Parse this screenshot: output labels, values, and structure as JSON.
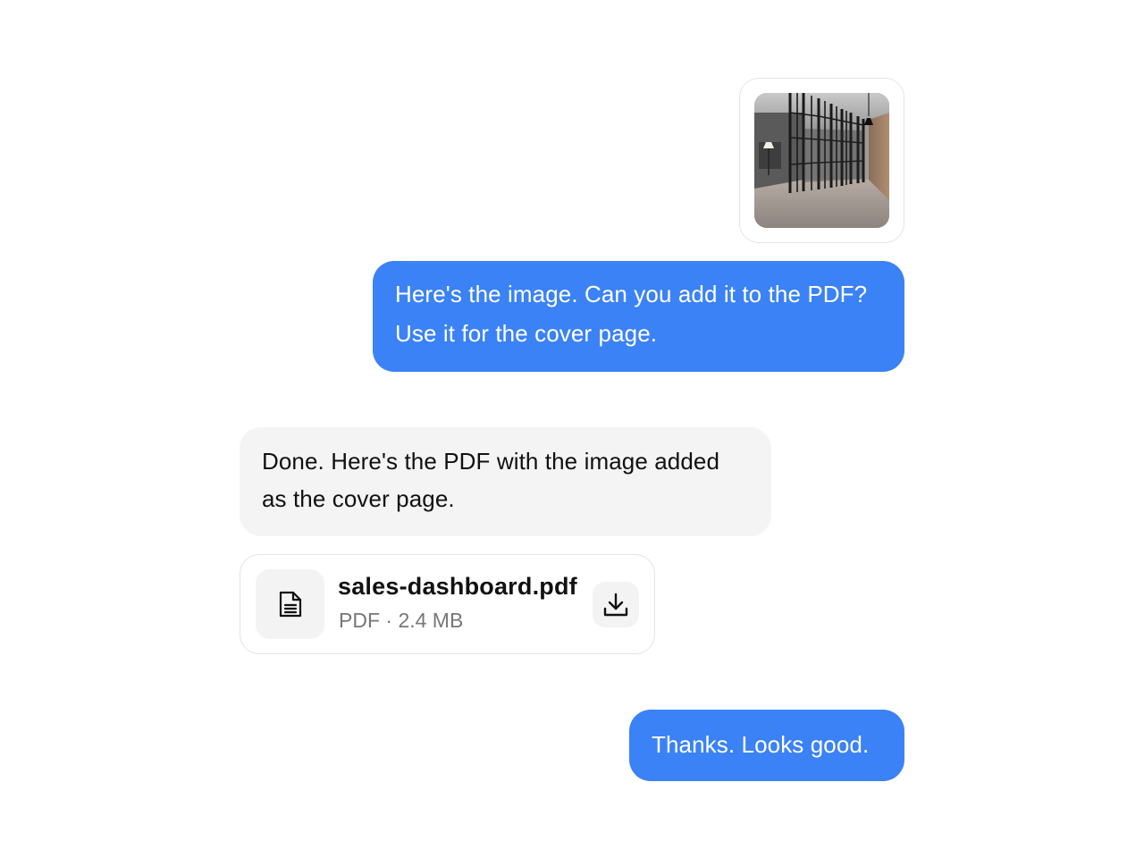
{
  "messages": [
    {
      "sender": "user",
      "attachment": {
        "type": "image",
        "icon": "office-corridor-photo"
      }
    },
    {
      "sender": "user",
      "text": "Here's the image. Can you add it to the PDF? Use it for the cover page."
    },
    {
      "sender": "assistant",
      "text": "Done. Here's the PDF with the image added as the cover page."
    },
    {
      "sender": "assistant",
      "file": {
        "name": "sales-dashboard.pdf",
        "meta": "PDF · 2.4 MB",
        "icon": "document-icon",
        "action_icon": "download-icon"
      }
    },
    {
      "sender": "user",
      "text": "Thanks. Looks good."
    }
  ],
  "colors": {
    "outgoing_bubble": "#3b82f6",
    "incoming_bubble": "#f4f4f4",
    "card_border": "#e3e3e3"
  }
}
